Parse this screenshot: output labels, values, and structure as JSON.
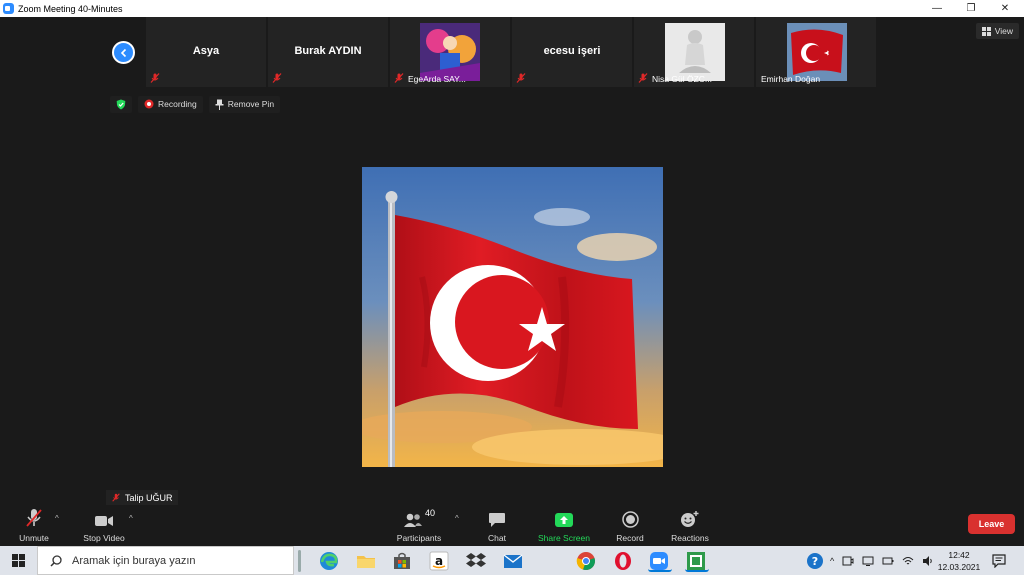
{
  "window": {
    "title": "Zoom Meeting 40-Minutes",
    "min": "—",
    "max": "❐",
    "close": "✕"
  },
  "strip": {
    "participants": [
      {
        "id": "asya",
        "display": "Asya",
        "label": ""
      },
      {
        "id": "burak",
        "display": "Burak AYDIN",
        "label": ""
      },
      {
        "id": "ege",
        "display": "",
        "label": "EgeArda SAY..."
      },
      {
        "id": "ecesu",
        "display": "ecesu işeri",
        "label": ""
      },
      {
        "id": "nisa",
        "display": "",
        "label": "Nisa Gül ÖZC..."
      },
      {
        "id": "emirhan",
        "display": "",
        "label": "Emirhan Doğan"
      }
    ]
  },
  "view_button": {
    "label": "View"
  },
  "status": {
    "recording": "Recording",
    "remove_pin": "Remove Pin"
  },
  "active_speaker": {
    "name": "Talip UĞUR"
  },
  "controls": {
    "unmute": "Unmute",
    "stop_video": "Stop Video",
    "participants": "Participants",
    "participants_count": "40",
    "chat": "Chat",
    "share_screen": "Share Screen",
    "record": "Record",
    "reactions": "Reactions",
    "leave": "Leave"
  },
  "colors": {
    "accent": "#2d8cff",
    "share_green": "#23d959",
    "leave_red": "#d9312f",
    "mic_off_red": "#e02828",
    "flag_red": "#d2141e"
  },
  "taskbar": {
    "search_placeholder": "Aramak için buraya yazın",
    "time": "12:42",
    "date": "12.03.2021"
  }
}
